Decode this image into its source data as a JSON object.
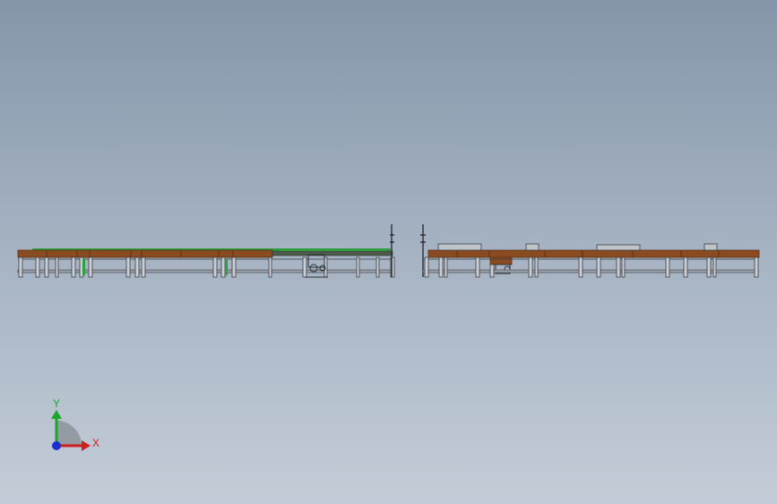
{
  "app": {
    "view": "cad-3d-viewport"
  },
  "colors": {
    "background_top": "#8596aa",
    "background_bottom": "#c3cdd8",
    "table_top": "#8a4b21",
    "table_top_edge": "#5b2f12",
    "frame": "#3b3f45",
    "frame_light": "#6d7278",
    "accent_green": "#2e9e3f",
    "axis_x": "#cc1f1f",
    "axis_y": "#1aa52b",
    "axis_z": "#1b2fd1"
  },
  "triad": {
    "x_label": "X",
    "y_label": "Y",
    "icon": "coordinate-triad-icon"
  }
}
